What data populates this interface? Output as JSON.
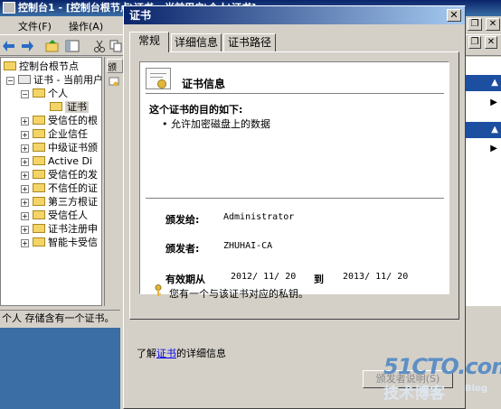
{
  "mmc": {
    "title": "控制台1 - [控制台根节点\\证书 - 当前用户\\个人\\证书]",
    "menu": [
      "文件(F)",
      "操作(A)"
    ],
    "tree": {
      "root": "控制台根节点",
      "store": "证书 - 当前用户",
      "personal": "个人",
      "personal_child": "证书",
      "items": [
        "受信任的根",
        "企业信任",
        "中级证书颁",
        "Active Di",
        "受信任的发",
        "不信任的证",
        "第三方根证",
        "受信任人",
        "证书注册申",
        "智能卡受信"
      ]
    },
    "mid_header": "颁",
    "status": "个人 存储含有一个证书。"
  },
  "dialog": {
    "title": "证书",
    "close_glyph": "✕",
    "tabs": [
      "常规",
      "详细信息",
      "证书路径"
    ],
    "cert_info_heading": "证书信息",
    "purpose_heading": "这个证书的目的如下:",
    "purposes": [
      "• 允许加密磁盘上的数据"
    ],
    "issued_to_label": "颁发给:",
    "issued_to_value": "Administrator",
    "issued_by_label": "颁发者:",
    "issued_by_value": "ZHUHAI-CA",
    "validity_label": "有效期从",
    "valid_from": "2012/ 11/ 20",
    "to_label": "到",
    "valid_to": "2013/ 11/ 20",
    "private_key_note": "您有一个与该证书对应的私钥。",
    "issuer_statement_button": "颁发者说明(S)",
    "learn_prefix": "了解",
    "learn_link": "证书",
    "learn_suffix": "的详细信息"
  },
  "watermark": {
    "site": "51CTO.com",
    "tag": "技术博客",
    "blog": "Blog"
  },
  "colors": {
    "titlebar": "#0a246a",
    "link": "#0000ee",
    "watermark": "#5e8fc4"
  }
}
